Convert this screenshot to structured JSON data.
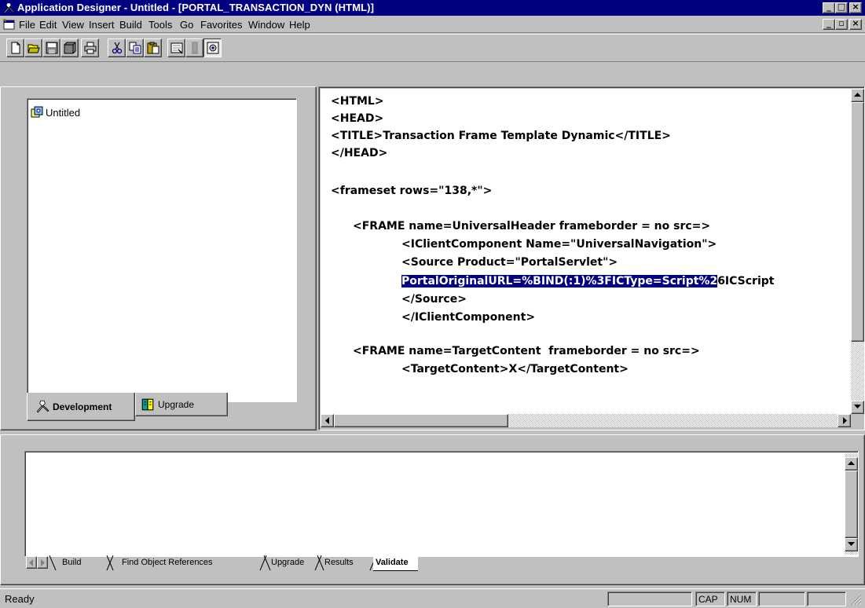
{
  "titlebar": {
    "title": "Application Designer - Untitled - [PORTAL_TRANSACTION_DYN (HTML)]",
    "buttons": [
      {
        "icon": "minimize-icon",
        "glyph": "_"
      },
      {
        "icon": "maximize-icon",
        "glyph": "□"
      },
      {
        "icon": "close-icon",
        "glyph": "×"
      }
    ]
  },
  "menubar": {
    "items": [
      "File",
      "Edit",
      "View",
      "Insert",
      "Build",
      "Tools",
      "Go",
      "Favorites",
      "Window",
      "Help"
    ],
    "mdi_buttons": [
      {
        "icon": "minimize-icon",
        "glyph": "_"
      },
      {
        "icon": "restore-icon",
        "glyph": "▫"
      },
      {
        "icon": "close-icon",
        "glyph": "×"
      }
    ]
  },
  "toolbar": {
    "buttons": [
      "new-icon",
      "open-icon",
      "save-icon",
      "save-all-icon",
      "print-icon",
      "cut-icon",
      "copy-icon",
      "paste-icon",
      "properties-icon",
      "disabled-icon",
      "project-workspace-icon"
    ]
  },
  "project": {
    "root_label": "Untitled",
    "tabs": [
      {
        "label": "Development",
        "active": true
      },
      {
        "label": "Upgrade",
        "active": false
      }
    ]
  },
  "editor": {
    "lines": [
      {
        "text": "<HTML>"
      },
      {
        "text": "<HEAD>"
      },
      {
        "text": "<TITLE>Transaction Frame Template Dynamic</TITLE>"
      },
      {
        "text": "</HEAD>"
      },
      {
        "text": "<frameset rows=\"138,*\">"
      },
      {
        "text": "<FRAME name=UniversalHeader frameborder = no src=>"
      },
      {
        "text": "<IClientComponent Name=\"UniversalNavigation\">"
      },
      {
        "text": "<Source Product=\"PortalServlet\">"
      },
      {
        "selected": "PortalOriginalURL=%BIND(:1)%3FICType=Script%2",
        "rest": "6ICScript"
      },
      {
        "text": "</Source>"
      },
      {
        "text": "</IClientComponent>"
      },
      {
        "text": "<FRAME name=TargetContent  frameborder = no src=>"
      },
      {
        "text": "<TargetContent>X</TargetContent>"
      }
    ]
  },
  "output": {
    "tabs": [
      "Build",
      "Find Object References",
      "Upgrade",
      "Results",
      "Validate"
    ],
    "active_tab": "Validate"
  },
  "statusbar": {
    "text": "Ready",
    "indicators": [
      "",
      "CAP",
      "NUM",
      "",
      ""
    ]
  },
  "colors": {
    "titlebar": "#000080",
    "selection": "#000080",
    "face": "#c0c0c0"
  }
}
